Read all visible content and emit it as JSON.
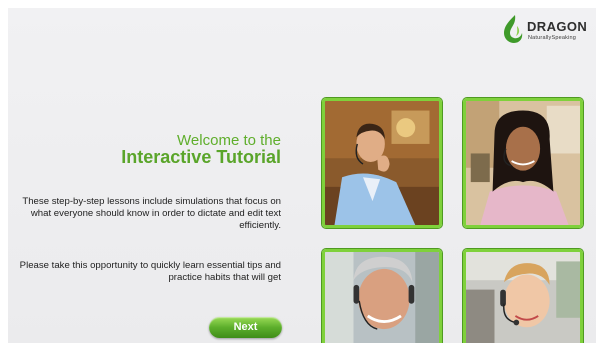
{
  "logo": {
    "brand": "DRAGON",
    "product": "NaturallySpeaking"
  },
  "intro": {
    "welcome": "Welcome to the",
    "title": "Interactive Tutorial",
    "paragraph1": "These step-by-step lessons include simulations that focus on what everyone should know in order to dictate and edit text efficiently.",
    "paragraph2": "Please take this opportunity to quickly learn essential tips and practice habits that will get"
  },
  "buttons": {
    "next": "Next"
  },
  "colors": {
    "accent": "#5aa52a",
    "tile_border": "#7fd13b",
    "background": "#eeeef0"
  },
  "photos": [
    {
      "icon": "man-with-headset-photo"
    },
    {
      "icon": "woman-with-headset-photo"
    },
    {
      "icon": "older-man-with-headset-photo"
    },
    {
      "icon": "boy-with-headset-photo"
    }
  ]
}
